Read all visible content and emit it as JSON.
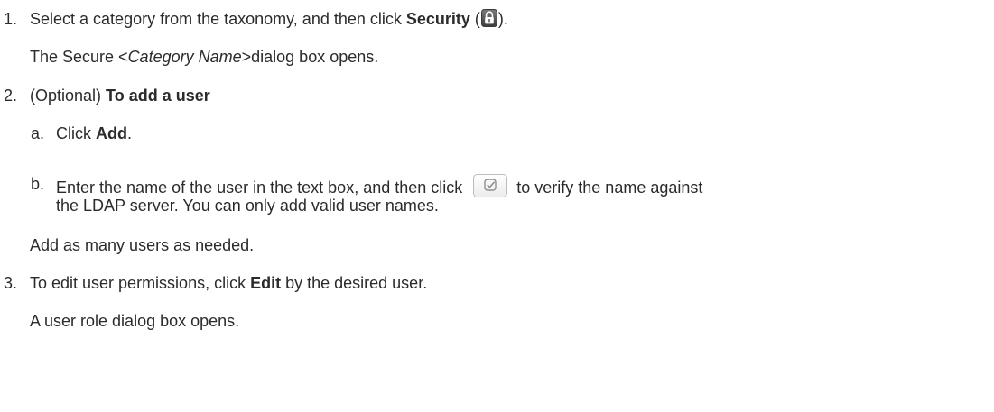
{
  "colors": {
    "text": "#2b2b2b",
    "icon_dark": "#555555",
    "icon_border": "#b9b9b9",
    "icon_check": "#8a8a8a"
  },
  "steps": [
    {
      "number": "1.",
      "pre": "Select a category from the taxonomy, and then click ",
      "bold": "Security",
      "open_paren": " (",
      "icon": "lock-icon",
      "close": ").",
      "result": {
        "pre": "The Secure <",
        "italic": "Category Name",
        "post": ">dialog box opens."
      }
    },
    {
      "number": "2.",
      "pre": "(Optional) ",
      "bold": "To add a user",
      "substeps": [
        {
          "letter": "a.",
          "pre": "Click ",
          "bold": "Add",
          "post": "."
        },
        {
          "letter": "b.",
          "line1_pre": "Enter the name of the user in the text box, and then click",
          "icon": "verify-check-icon",
          "line1_post": "to verify the name against",
          "line2": "the LDAP server. You can only add valid user names."
        }
      ],
      "result": "Add as many users as needed."
    },
    {
      "number": "3.",
      "pre": "To edit user permissions, click ",
      "bold": "Edit",
      "post": " by the desired user.",
      "result": "A user role dialog box opens."
    }
  ]
}
